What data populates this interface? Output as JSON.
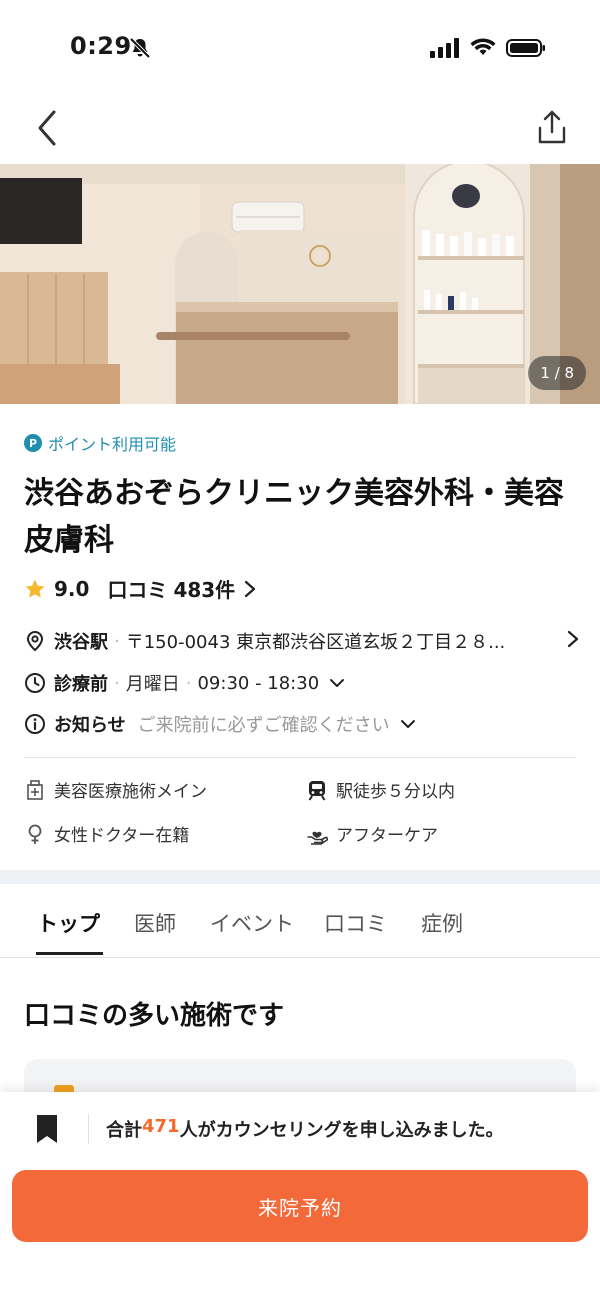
{
  "status_bar": {
    "time": "0:29"
  },
  "hero": {
    "photo_counter": "1 / 8"
  },
  "clinic": {
    "points_label": "ポイント利用可能",
    "points_icon_letter": "P",
    "name": "渋谷あおぞらクリニック美容外科・美容皮膚科",
    "rating": "9.0",
    "review_label": "口コミ",
    "review_count": "483件"
  },
  "info": {
    "station": "渋谷駅",
    "address": "〒150-0043 東京都渋谷区道玄坂２丁目２８...",
    "hours_status": "診療前",
    "hours_day": "月曜日",
    "hours_time": "09:30 - 18:30",
    "notice_label": "お知らせ",
    "notice_text": "ご来院前に必ずご確認ください"
  },
  "features": [
    {
      "label": "美容医療施術メイン",
      "icon": "clinic-building-icon"
    },
    {
      "label": "駅徒歩５分以内",
      "icon": "train-icon"
    },
    {
      "label": "女性ドクター在籍",
      "icon": "female-icon"
    },
    {
      "label": "アフターケア",
      "icon": "aftercare-hand-icon"
    }
  ],
  "tabs": [
    {
      "label": "トップ",
      "active": true
    },
    {
      "label": "医師",
      "active": false
    },
    {
      "label": "イベント",
      "active": false
    },
    {
      "label": "口コミ",
      "active": false
    },
    {
      "label": "症例",
      "active": false
    }
  ],
  "section": {
    "title": "口コミの多い施術です"
  },
  "bottom": {
    "counsel_prefix": "合計",
    "counsel_count": "471",
    "counsel_suffix": "人がカウンセリングを申し込みました。",
    "reserve_label": "来院予約"
  },
  "colors": {
    "accent": "#f4693a",
    "points": "#1f8fb0",
    "star": "#f5b82e"
  }
}
